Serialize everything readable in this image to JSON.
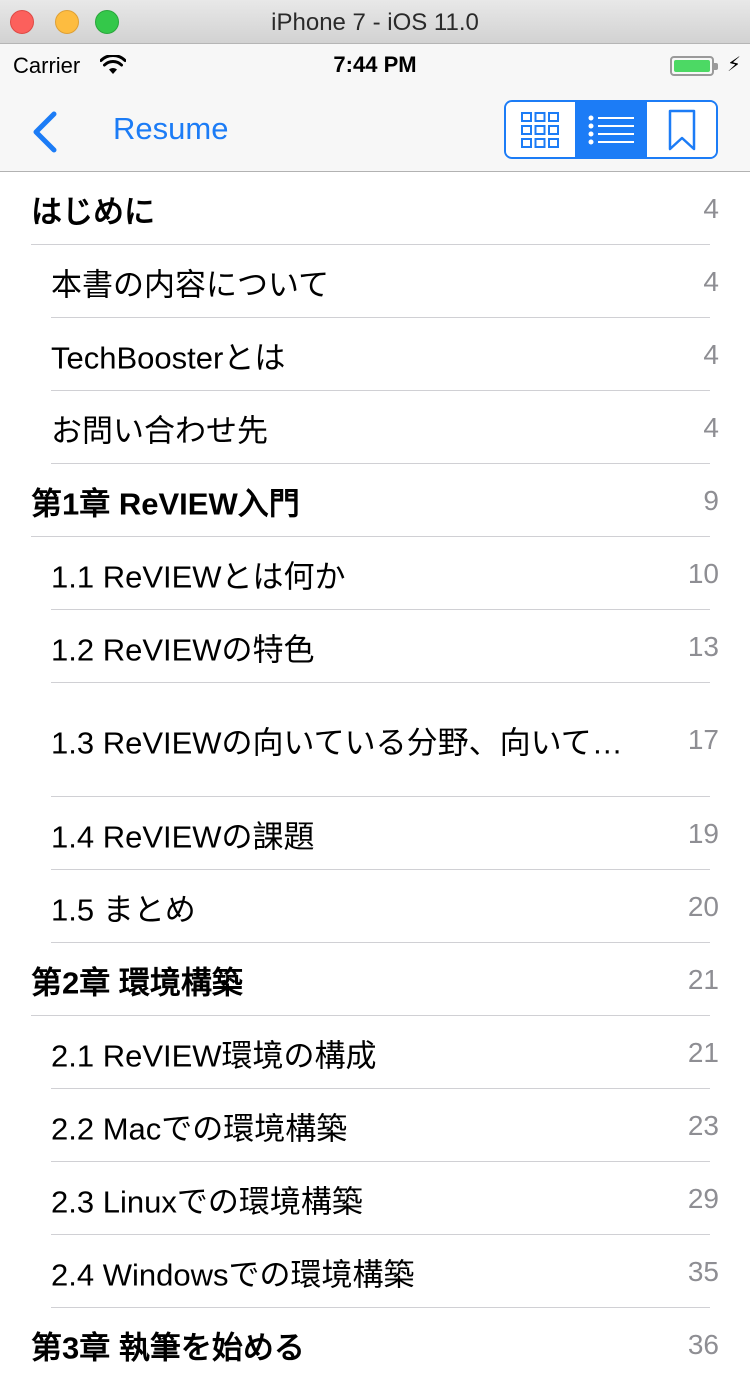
{
  "window": {
    "title": "iPhone 7 - iOS 11.0"
  },
  "status_bar": {
    "carrier": "Carrier",
    "time": "7:44 PM",
    "battery_color": "#4cd964"
  },
  "nav": {
    "back_label": "Resume",
    "accent_color": "#1c7cf6",
    "segments": [
      {
        "name": "grid-view",
        "icon": "grid-icon",
        "selected": false
      },
      {
        "name": "list-view",
        "icon": "list-icon",
        "selected": true
      },
      {
        "name": "bookmarks",
        "icon": "bookmark-icon",
        "selected": false
      }
    ]
  },
  "toc": [
    {
      "title": "はじめに",
      "page": "4",
      "level": "chapter"
    },
    {
      "title": "本書の内容について",
      "page": "4",
      "level": "section"
    },
    {
      "title": "TechBoosterとは",
      "page": "4",
      "level": "section"
    },
    {
      "title": "お問い合わせ先",
      "page": "4",
      "level": "section"
    },
    {
      "title": "第1章 ReVIEW入門",
      "page": "9",
      "level": "chapter"
    },
    {
      "title": "1.1 ReVIEWとは何か",
      "page": "10",
      "level": "section"
    },
    {
      "title": "1.2 ReVIEWの特色",
      "page": "13",
      "level": "section"
    },
    {
      "title": "1.3 ReVIEWの向いている分野、向いて…",
      "page": "17",
      "level": "section"
    },
    {
      "title": "1.4 ReVIEWの課題",
      "page": "19",
      "level": "section"
    },
    {
      "title": "1.5 まとめ",
      "page": "20",
      "level": "section"
    },
    {
      "title": "第2章 環境構築",
      "page": "21",
      "level": "chapter"
    },
    {
      "title": "2.1 ReVIEW環境の構成",
      "page": "21",
      "level": "section"
    },
    {
      "title": "2.2 Macでの環境構築",
      "page": "23",
      "level": "section"
    },
    {
      "title": "2.3 Linuxでの環境構築",
      "page": "29",
      "level": "section"
    },
    {
      "title": "2.4 Windowsでの環境構築",
      "page": "35",
      "level": "section"
    },
    {
      "title": "第3章 執筆を始める",
      "page": "36",
      "level": "chapter"
    }
  ]
}
